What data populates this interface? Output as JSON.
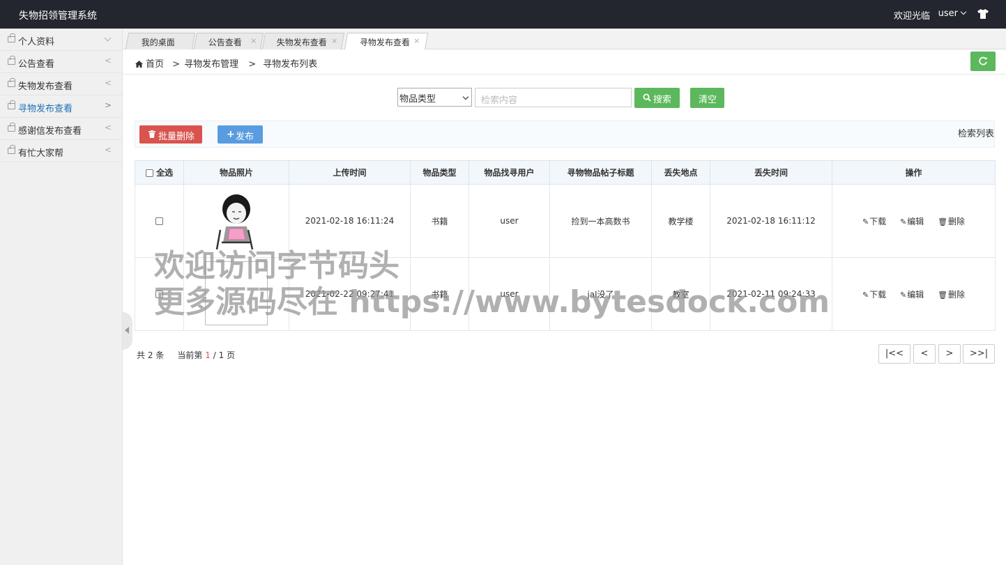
{
  "header": {
    "app_title": "失物招领管理系统",
    "welcome": "欢迎光临",
    "username": "user"
  },
  "sidebar": {
    "items": [
      {
        "label": "个人资料",
        "arrow": "down"
      },
      {
        "label": "公告查看",
        "arrow": "<"
      },
      {
        "label": "失物发布查看",
        "arrow": "<"
      },
      {
        "label": "寻物发布查看",
        "arrow": ">",
        "active": true
      },
      {
        "label": "感谢信发布查看",
        "arrow": "<"
      },
      {
        "label": "有忙大家帮",
        "arrow": "<"
      }
    ]
  },
  "tabs": [
    {
      "label": "我的桌面",
      "close": ""
    },
    {
      "label": "公告查看",
      "close": "×"
    },
    {
      "label": "失物发布查看",
      "close": "×"
    },
    {
      "label": "寻物发布查看",
      "close": "×"
    }
  ],
  "breadcrumb": {
    "home": "首页",
    "level1": "寻物发布管理",
    "level2": "寻物发布列表",
    "sep": ">"
  },
  "search": {
    "select_value": "物品类型",
    "placeholder": "检索内容",
    "search_label": "搜索",
    "clear_label": "清空"
  },
  "toolbar": {
    "batch_delete_label": "批量删除",
    "publish_label": "发布",
    "list_label": "检索列表"
  },
  "table": {
    "columns": [
      "全选",
      "物品照片",
      "上传时间",
      "物品类型",
      "物品找寻用户",
      "寻物物品帖子标题",
      "丢失地点",
      "丢失时间",
      "操作"
    ],
    "rows": [
      {
        "upload_time": "2021-02-18 16:11:24",
        "type": "书籍",
        "user": "user",
        "title": "捡到一本高数书",
        "location": "教学楼",
        "lost_time": "2021-02-18 16:11:12"
      },
      {
        "upload_time": "2021-02-22 09:27:41",
        "type": "书籍",
        "user": "user",
        "title": "jal没了",
        "location": "教室",
        "lost_time": "2021-02-11 09:24:33"
      }
    ],
    "actions": {
      "download": "下载",
      "edit": "编辑",
      "delete": "删除"
    }
  },
  "watermark": {
    "line1": "欢迎访问字节码头",
    "line2": "更多源码尽在 https://www.bytesdock.com"
  },
  "pagination": {
    "total_prefix": "共",
    "total": "2",
    "total_suffix": "条",
    "current_prefix": "当前第",
    "current": "1",
    "slash": "/",
    "pages": "1",
    "pages_suffix": "页",
    "first": "|<<",
    "prev": "<",
    "next": ">",
    "last": ">>|"
  },
  "colors": {
    "topbar": "#23262e",
    "green": "#5cb85c",
    "red": "#d9534f",
    "blue": "#5a9ce0",
    "active_link": "#1e6fb8"
  }
}
